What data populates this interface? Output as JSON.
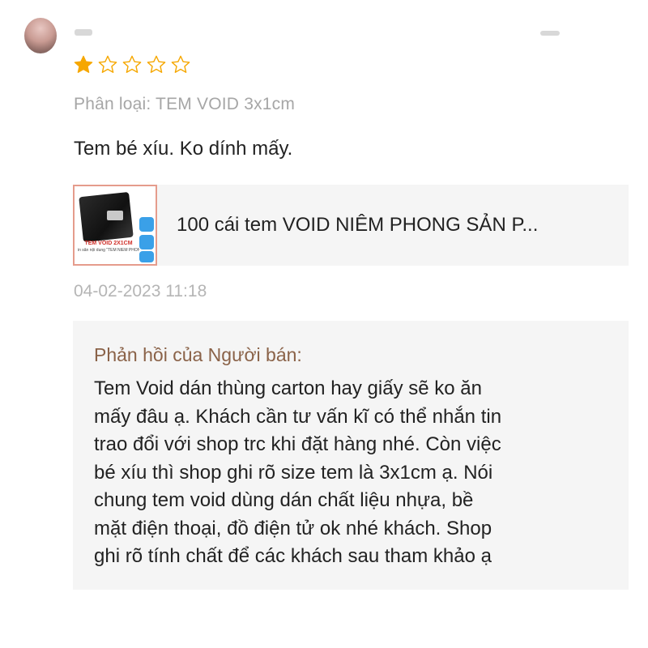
{
  "review": {
    "rating": 1,
    "max_rating": 5,
    "colors": {
      "star_filled": "#f6a700",
      "star_empty_stroke": "#f6a700"
    },
    "variation": "Phân loại: TEM VOID 3x1cm",
    "text": "Tem bé xíu. Ko dính mấy.",
    "timestamp": "04-02-2023 11:18"
  },
  "product": {
    "name": "100 cái tem VOID NIÊM PHONG SẢN P...",
    "thumbnail_caption": "TEM VOID 2X1CM",
    "thumbnail_subcaption": "in sẵn nội dung \"TEM NIÊM PHONG\""
  },
  "seller_reply": {
    "title": "Phản hồi của Người bán:",
    "lines": [
      "Tem Void dán thùng carton hay giấy sẽ ko ăn",
      "mấy đâu ạ. Khách cần tư vấn kĩ có thể nhắn tin",
      "trao đổi với shop trc khi đặt hàng nhé. Còn việc",
      "bé xíu thì shop ghi rõ size tem là 3x1cm ạ. Nói",
      "chung tem void dùng dán chất liệu nhựa, bề",
      "mặt điện thoại, đồ điện tử ok nhé khách. Shop",
      "ghi rõ tính chất để các khách sau tham khảo ạ"
    ],
    "title_color": "#8a6248"
  }
}
